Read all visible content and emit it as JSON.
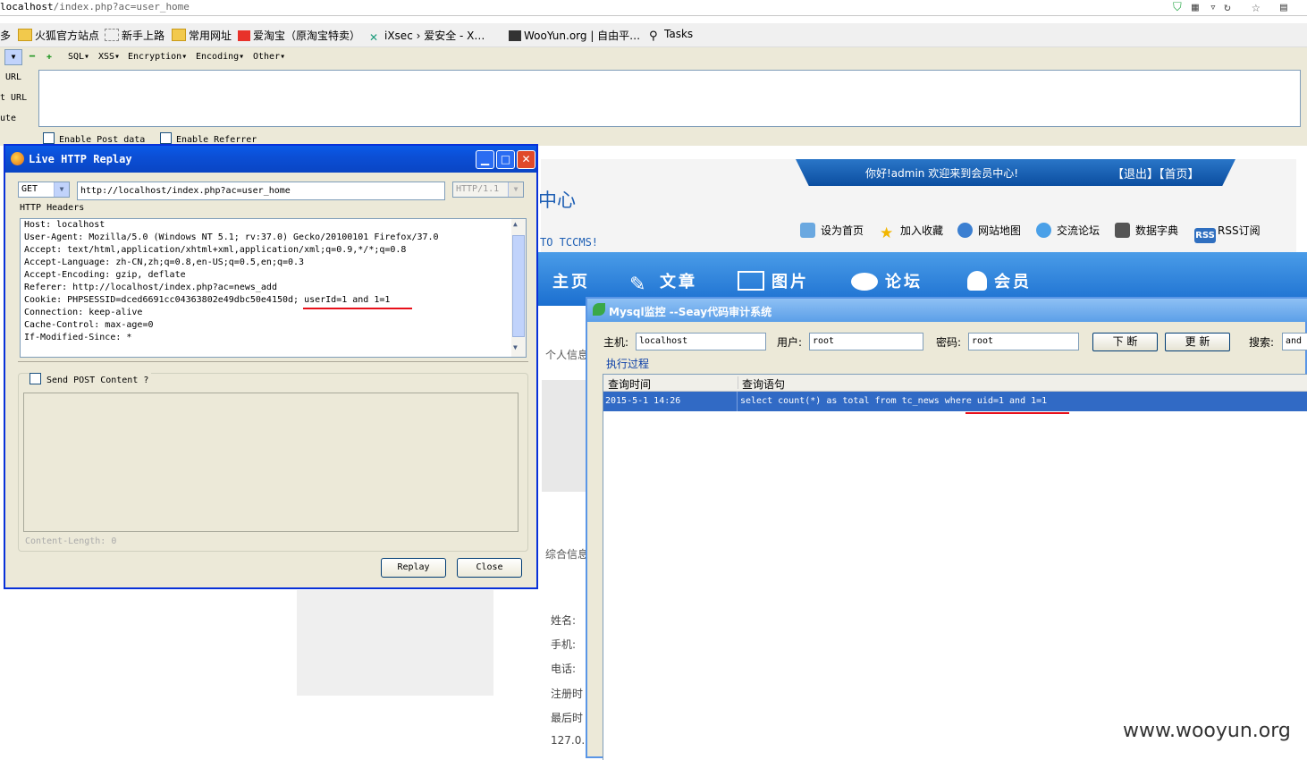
{
  "browser": {
    "url_host": "localhost",
    "url_path": "/index.php?ac=user_home",
    "bookmarks": [
      {
        "label": "多",
        "icon": "more-icon"
      },
      {
        "label": "火狐官方站点",
        "icon": "folder-icon"
      },
      {
        "label": "新手上路",
        "icon": "page-icon"
      },
      {
        "label": "常用网址",
        "icon": "folder-icon"
      },
      {
        "label": "爱淘宝（原淘宝特卖）",
        "icon": "taobao-icon"
      },
      {
        "label": "iXsec › 爱安全 - X…",
        "icon": "ixsec-icon"
      },
      {
        "label": "WooYun.org | 自由平…",
        "icon": "wooyun-icon"
      },
      {
        "label": "Tasks",
        "icon": "search-icon"
      }
    ]
  },
  "hackbar": {
    "menus": [
      "SQL▾",
      "XSS▾",
      "Encryption▾",
      "Encoding▾",
      "Other▾"
    ],
    "labels": [
      "URL",
      "t URL",
      "ute"
    ],
    "enable_post": "Enable Post data",
    "enable_referrer": "Enable Referrer"
  },
  "site": {
    "welcome": "你好!admin 欢迎来到会员中心!",
    "logout": "【退出】",
    "home": "【首页】",
    "center_title": "中心",
    "tccms": "TO TCCMS!",
    "top_links": [
      "设为首页",
      "加入收藏",
      "网站地图",
      "交流论坛",
      "数据字典",
      "RSS订阅"
    ],
    "rss_badge": "RSS",
    "nav": [
      "主页",
      "文章",
      "图片",
      "论坛",
      "会员"
    ],
    "sidebar_personal": "个人信息",
    "sidebar_summary": "综合信息",
    "info_labels": [
      "姓名:",
      "手机:",
      "电话:",
      "注册时",
      "最后时",
      "127.0."
    ]
  },
  "replay": {
    "title": "Live HTTP Replay",
    "method": "GET",
    "url": "http://localhost/index.php?ac=user_home",
    "version": "HTTP/1.1",
    "headers_label": "HTTP Headers",
    "headers": [
      "Host: localhost",
      "User-Agent: Mozilla/5.0 (Windows NT 5.1; rv:37.0) Gecko/20100101 Firefox/37.0",
      "Accept: text/html,application/xhtml+xml,application/xml;q=0.9,*/*;q=0.8",
      "Accept-Language: zh-CN,zh;q=0.8,en-US;q=0.5,en;q=0.3",
      "Accept-Encoding: gzip, deflate",
      "Referer: http://localhost/index.php?ac=news_add",
      "Cookie: PHPSESSID=dced6691cc04363802e49dbc50e4150d; userId=1 and 1=1",
      "Connection: keep-alive",
      "Cache-Control: max-age=0",
      "If-Modified-Since: *"
    ],
    "send_post": "Send POST Content ?",
    "content_length": "Content-Length:  0",
    "replay_btn": "Replay",
    "close_btn": "Close"
  },
  "mysql": {
    "title": "Mysql监控 --Seay代码审计系统",
    "host_label": "主机:",
    "host_value": "localhost",
    "user_label": "用户:",
    "user_value": "root",
    "pass_label": "密码:",
    "pass_value": "root",
    "break_btn": "下 断",
    "refresh_btn": "更 新",
    "search_label": "搜索:",
    "search_value": "and",
    "exec_label": "执行过程",
    "col_time": "查询时间",
    "col_sql": "查询语句",
    "rows": [
      {
        "time": "2015-5-1 14:26",
        "sql": "select count(*) as total from tc_news where uid=1 and 1=1"
      }
    ]
  },
  "watermark": "www.wooyun.org",
  "colors": {
    "accent": "#1b6fd0",
    "xp_title": "#0a5ae8",
    "highlight": "#e8101a"
  }
}
